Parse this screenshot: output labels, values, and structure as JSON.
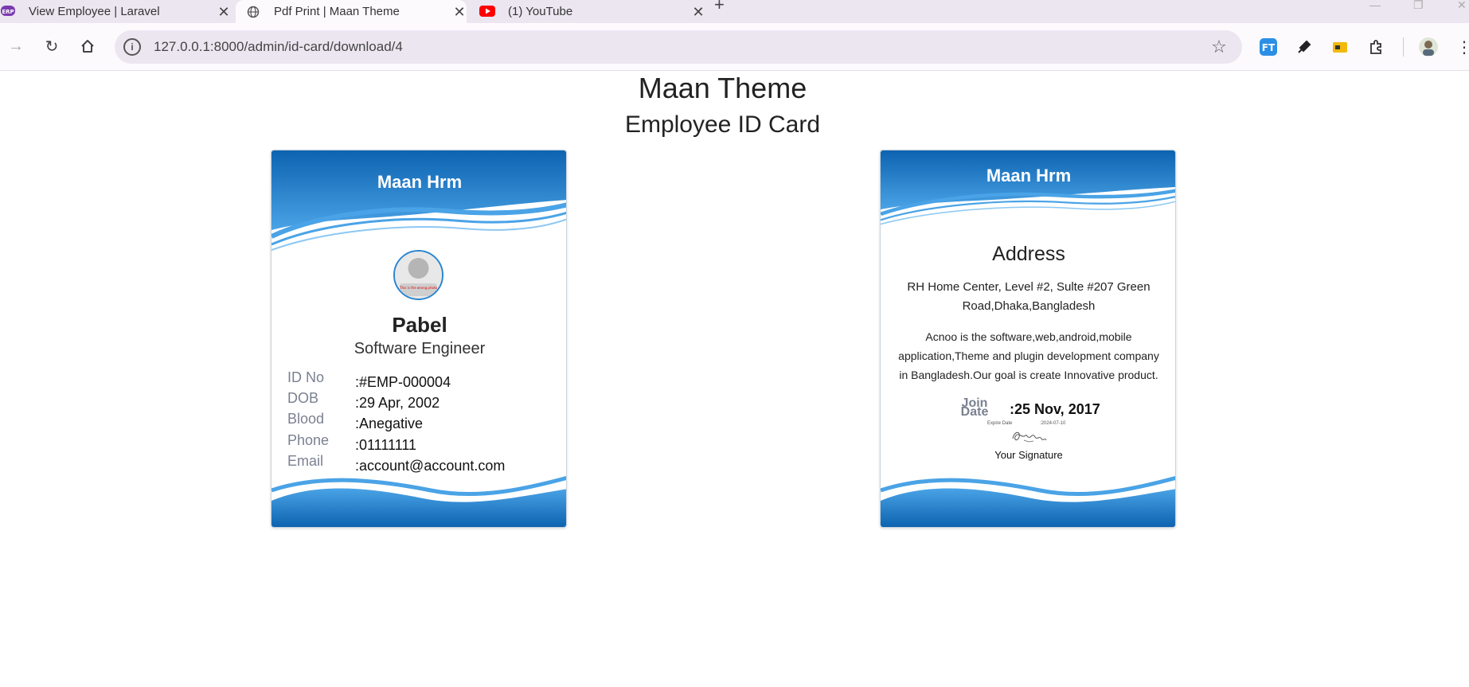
{
  "browser": {
    "tabs": [
      {
        "title": "View Employee | Laravel",
        "favicon": "erp-icon"
      },
      {
        "title": "Pdf Print | Maan Theme",
        "favicon": "globe-icon"
      },
      {
        "title": "(1) YouTube",
        "favicon": "youtube-icon"
      }
    ],
    "url": "127.0.0.1:8000/admin/id-card/download/4",
    "colors": {
      "tabbar": "#ece6f1",
      "toolbar": "#fdfafe",
      "omnibox": "#ece6f1"
    }
  },
  "page": {
    "title": "Maan Theme",
    "subtitle": "Employee ID Card"
  },
  "front": {
    "brand": "Maan Hrm",
    "name": "Pabel",
    "designation": "Software Engineer",
    "photo_caption": "This is the wrong photo",
    "fields": [
      {
        "label": "ID No",
        "value": ":#EMP-000004"
      },
      {
        "label": "DOB",
        "value": ":29 Apr, 2002"
      },
      {
        "label": "Blood",
        "value": ":Anegative"
      },
      {
        "label": "Phone",
        "value": ":01111111"
      },
      {
        "label": "Email",
        "value": ":account@account.com"
      }
    ]
  },
  "back": {
    "brand": "Maan Hrm",
    "address_title": "Address",
    "address": "RH Home Center, Level #2, Sulte #207 Green Road,Dhaka,Bangladesh",
    "about": "Acnoo is the software,web,android,mobile application,Theme and plugin development company in Bangladesh.Our goal is create Innovative product.",
    "join_label": "Join Date",
    "join_value": ":25 Nov, 2017",
    "expire_label": "Expire Date",
    "expire_value": ":2024-07-10",
    "signature_label": "Your Signature"
  },
  "colors": {
    "card_blue_dark": "#0d63b0",
    "card_blue_light": "#4aa3e6",
    "label_gray": "#7a8190"
  }
}
